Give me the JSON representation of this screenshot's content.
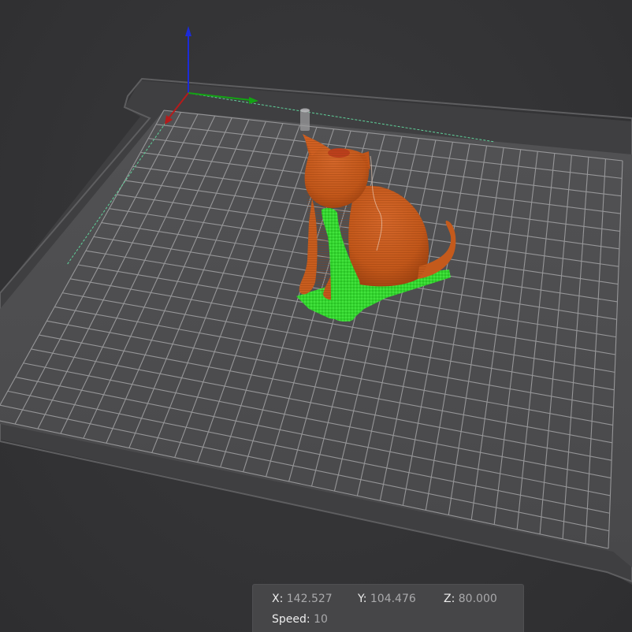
{
  "viewport": {
    "background": "#323234",
    "bed_color": "#4e4e50",
    "bed_edge_color": "#5c5c5e",
    "grid_color": "#9a9a9c",
    "model_color": "#c2571a",
    "support_color": "#2fd62b",
    "axis_colors": {
      "x": "#b51b1b",
      "y": "#13a313",
      "z": "#1c2bd8"
    }
  },
  "readout": {
    "x_label": "X:",
    "x_value": "142.527",
    "y_label": "Y:",
    "y_value": "104.476",
    "z_label": "Z:",
    "z_value": "80.000",
    "speed_label": "Speed:",
    "speed_value": "10"
  }
}
